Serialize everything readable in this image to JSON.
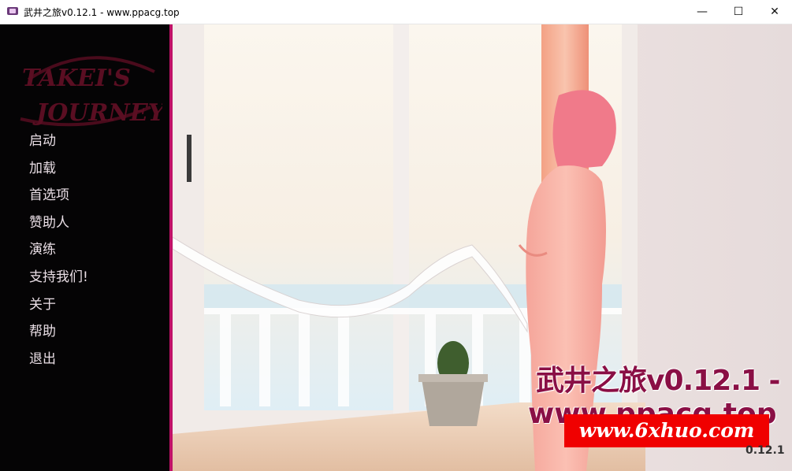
{
  "window": {
    "title": "武井之旅v0.12.1 - www.ppacg.top",
    "app_icon": "game-app-icon",
    "controls": {
      "minimize": "—",
      "maximize": "☐",
      "close": "✕"
    }
  },
  "logo": {
    "line1": "TAKEI'S",
    "line2": "JOURNEY"
  },
  "menu": {
    "items": [
      "启动",
      "加载",
      "首选项",
      "赞助人",
      "演练",
      "支持我们!",
      "关于",
      "帮助",
      "退出"
    ]
  },
  "watermarks": {
    "line1": "武井之旅v0.12.1 -",
    "line2": "www.ppacg.top",
    "banner": "www.6xhuo.com",
    "version": "0.12.1"
  },
  "colors": {
    "sidebar": "#050405",
    "accent_edge": "#c01268",
    "watermark_text": "#8a0f45",
    "banner_bg": "#f00000"
  }
}
